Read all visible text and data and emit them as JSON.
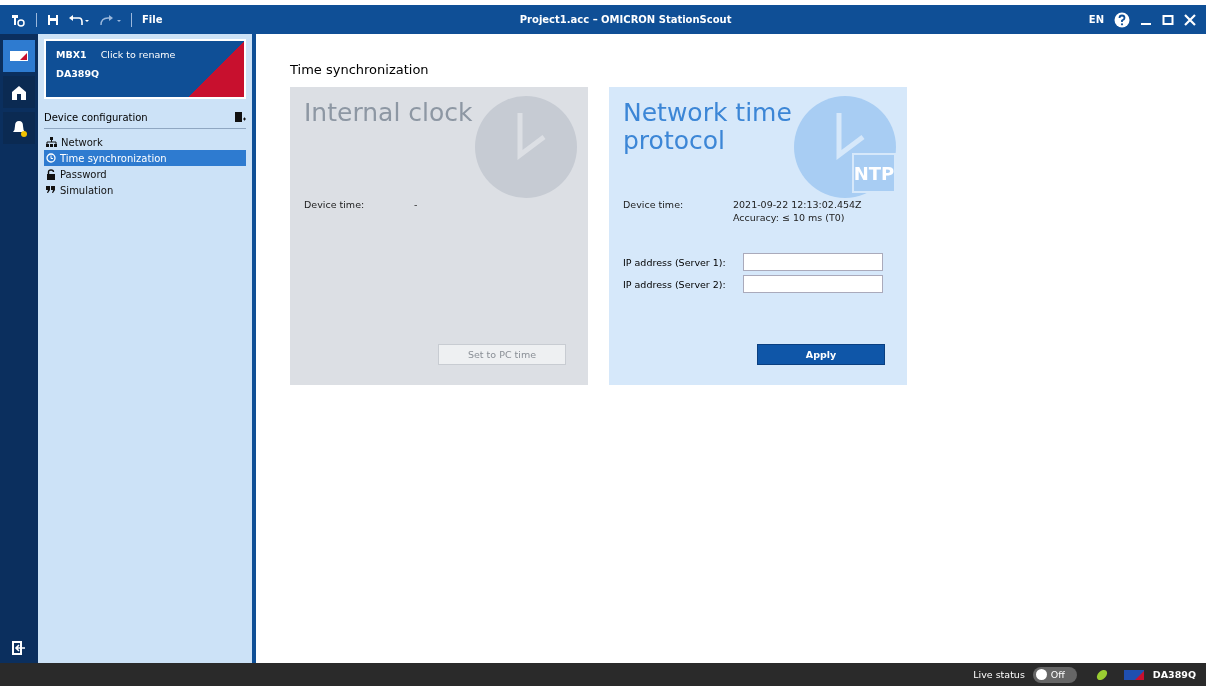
{
  "window": {
    "title": "Project1.acc – OMICRON StationScout",
    "menu": "File",
    "language": "EN"
  },
  "rail": [
    {
      "kind": "device",
      "selected": true
    },
    {
      "kind": "substation",
      "selected": false
    },
    {
      "kind": "alerts",
      "selected": false
    }
  ],
  "device": {
    "name": "MBX1",
    "rename": "Click to rename",
    "serial": "DA389Q"
  },
  "sidebar": {
    "title": "Device configuration",
    "items": [
      {
        "kind": "network",
        "label": "Network",
        "selected": false
      },
      {
        "kind": "clock",
        "label": "Time synchronization",
        "selected": true
      },
      {
        "kind": "lock",
        "label": "Password",
        "selected": false
      },
      {
        "kind": "quote",
        "label": "Simulation",
        "selected": false
      }
    ]
  },
  "page_title": "Time synchronization",
  "cards": [
    {
      "kind": "internal",
      "title": "Internal clock",
      "active": false,
      "device_time_label": "Device time:",
      "device_time": "-",
      "button": "Set to PC time"
    },
    {
      "kind": "ntp",
      "title": "Network time protocol",
      "badge": "NTP",
      "active": true,
      "device_time_label": "Device time:",
      "device_time": "2021-09-22 12:13:02.454Z",
      "accuracy": "Accuracy: ≤ 10 ms (T0)",
      "fields": [
        {
          "label": "IP address (Server 1):"
        },
        {
          "label": "IP address (Server 2):"
        }
      ],
      "button": "Apply"
    }
  ],
  "status_bar": {
    "live_label": "Live status",
    "live": {
      "on": false,
      "label": "Off"
    },
    "device": "DA389Q"
  }
}
